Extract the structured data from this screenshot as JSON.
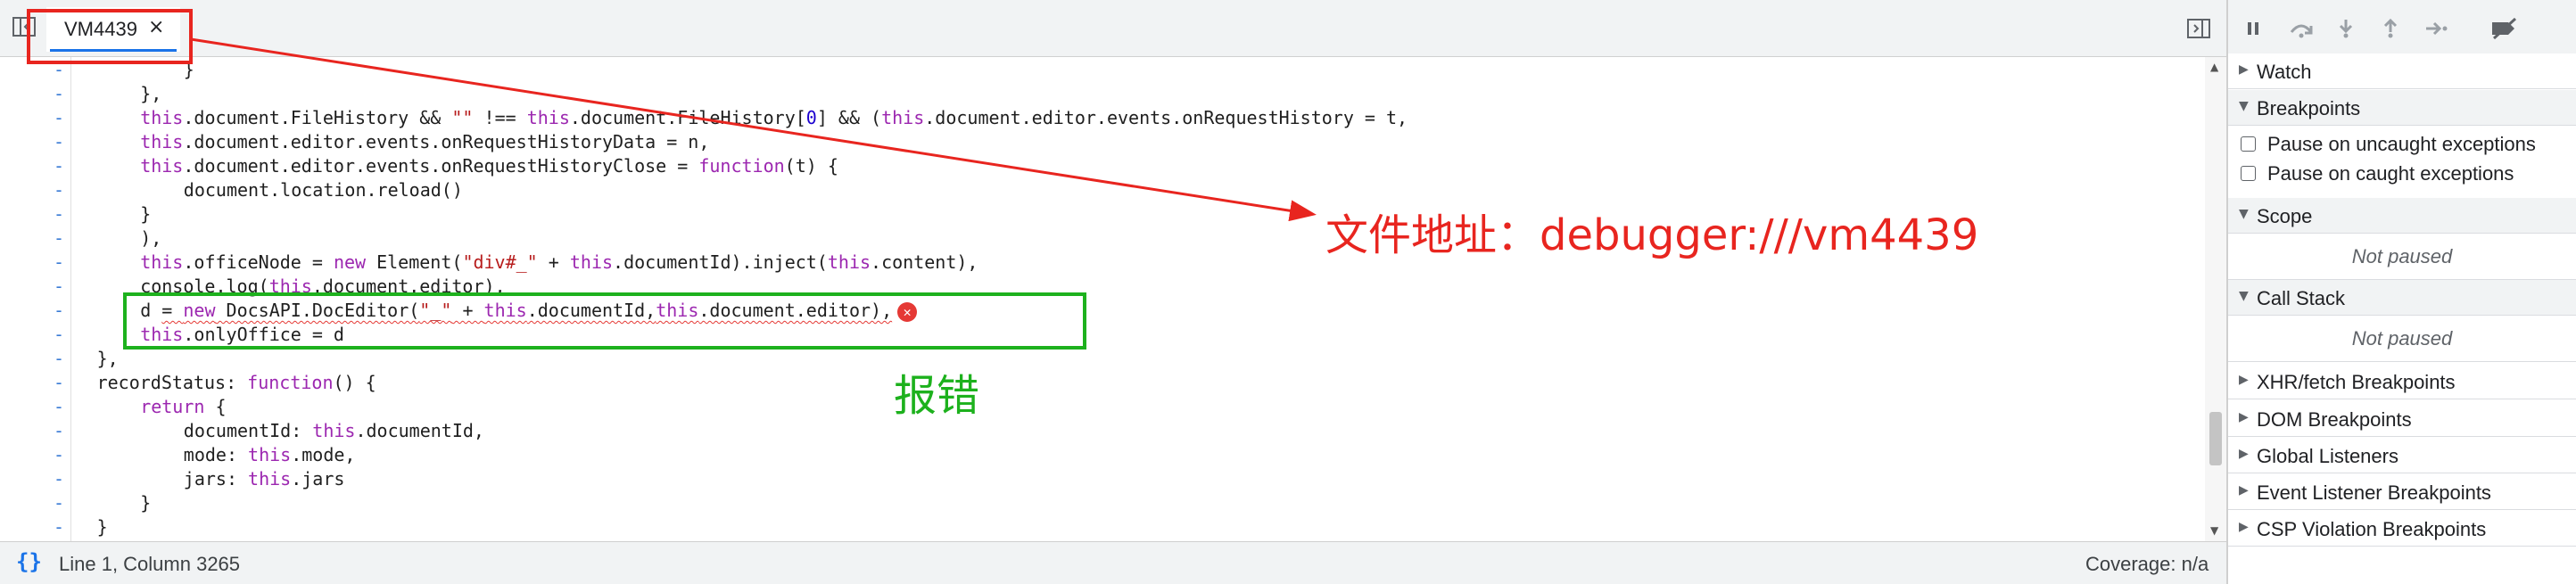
{
  "tab": {
    "label": "VM4439",
    "close": "×"
  },
  "code": [
    {
      "indent": 3,
      "parts": [
        {
          "t": "}"
        }
      ]
    },
    {
      "indent": 2,
      "parts": [
        {
          "t": "},"
        }
      ]
    },
    {
      "indent": 2,
      "parts": [
        {
          "t": "this",
          "c": "kw"
        },
        {
          "t": ".document.FileHistory && "
        },
        {
          "t": "\"\"",
          "c": "str"
        },
        {
          "t": " !== "
        },
        {
          "t": "this",
          "c": "kw"
        },
        {
          "t": ".document.FileHistory["
        },
        {
          "t": "0",
          "c": "num"
        },
        {
          "t": "] && ("
        },
        {
          "t": "this",
          "c": "kw"
        },
        {
          "t": ".document.editor.events.onRequestHistory = t,"
        }
      ]
    },
    {
      "indent": 2,
      "parts": [
        {
          "t": "this",
          "c": "kw"
        },
        {
          "t": ".document.editor.events.onRequestHistoryData = n,"
        }
      ]
    },
    {
      "indent": 2,
      "parts": [
        {
          "t": "this",
          "c": "kw"
        },
        {
          "t": ".document.editor.events.onRequestHistoryClose = "
        },
        {
          "t": "function",
          "c": "kw"
        },
        {
          "t": "(t) {"
        }
      ]
    },
    {
      "indent": 3,
      "parts": [
        {
          "t": "document.location.reload()"
        }
      ]
    },
    {
      "indent": 2,
      "parts": [
        {
          "t": "}"
        }
      ]
    },
    {
      "indent": 2,
      "parts": [
        {
          "t": "),"
        }
      ]
    },
    {
      "indent": 2,
      "parts": [
        {
          "t": "this",
          "c": "kw"
        },
        {
          "t": ".officeNode = "
        },
        {
          "t": "new",
          "c": "kw"
        },
        {
          "t": " Element("
        },
        {
          "t": "\"div#_\"",
          "c": "str"
        },
        {
          "t": " + "
        },
        {
          "t": "this",
          "c": "kw"
        },
        {
          "t": ".documentId).inject("
        },
        {
          "t": "this",
          "c": "kw"
        },
        {
          "t": ".content),"
        }
      ]
    },
    {
      "indent": 2,
      "parts": [
        {
          "t": "console.log("
        },
        {
          "t": "this",
          "c": "kw"
        },
        {
          "t": ".document.editor),"
        }
      ]
    },
    {
      "indent": 2,
      "error": true,
      "parts": [
        {
          "t": "d "
        },
        {
          "t": "= ",
          "w": true
        },
        {
          "t": "new",
          "c": "kw",
          "w": true
        },
        {
          "t": " DocsAPI.DocEditor(",
          "w": true
        },
        {
          "t": "\"_\"",
          "c": "str",
          "w": true
        },
        {
          "t": " + ",
          "w": true
        },
        {
          "t": "this",
          "c": "kw",
          "w": true
        },
        {
          "t": ".documentId,",
          "w": true
        },
        {
          "t": "this",
          "c": "kw",
          "w": true
        },
        {
          "t": ".document.editor),",
          "w": true
        }
      ]
    },
    {
      "indent": 2,
      "parts": [
        {
          "t": "this",
          "c": "kw"
        },
        {
          "t": ".onlyOffice = d"
        }
      ]
    },
    {
      "indent": 1,
      "parts": [
        {
          "t": "},"
        }
      ]
    },
    {
      "indent": 1,
      "parts": [
        {
          "t": "recordStatus: "
        },
        {
          "t": "function",
          "c": "kw"
        },
        {
          "t": "() {"
        }
      ]
    },
    {
      "indent": 2,
      "parts": [
        {
          "t": "return",
          "c": "kw"
        },
        {
          "t": " {"
        }
      ]
    },
    {
      "indent": 3,
      "parts": [
        {
          "t": "documentId: "
        },
        {
          "t": "this",
          "c": "kw"
        },
        {
          "t": ".documentId,"
        }
      ]
    },
    {
      "indent": 3,
      "parts": [
        {
          "t": "mode: "
        },
        {
          "t": "this",
          "c": "kw"
        },
        {
          "t": ".mode,"
        }
      ]
    },
    {
      "indent": 3,
      "parts": [
        {
          "t": "jars: "
        },
        {
          "t": "this",
          "c": "kw"
        },
        {
          "t": ".jars"
        }
      ]
    },
    {
      "indent": 2,
      "parts": [
        {
          "t": "}"
        }
      ]
    },
    {
      "indent": 1,
      "parts": [
        {
          "t": "}"
        }
      ]
    }
  ],
  "gutter_marker": "-",
  "status": {
    "braces": "{}",
    "position": "Line 1, Column 3265",
    "coverage": "Coverage: n/a"
  },
  "sidebar": {
    "watch": "Watch",
    "breakpoints": "Breakpoints",
    "pause_uncaught": "Pause on uncaught exceptions",
    "pause_caught": "Pause on caught exceptions",
    "scope": "Scope",
    "scope_status": "Not paused",
    "call_stack": "Call Stack",
    "call_stack_status": "Not paused",
    "xhr": "XHR/fetch Breakpoints",
    "dom": "DOM Breakpoints",
    "global": "Global Listeners",
    "event": "Event Listener Breakpoints",
    "csp": "CSP Violation Breakpoints"
  },
  "annotations": {
    "file_address": "文件地址：debugger:///vm4439",
    "error_label": "报错",
    "red": "#e8251f",
    "green": "#1db11d"
  },
  "colors": {
    "accent": "#1a73e8",
    "keyword": "#9c27b0",
    "string": "#b71c1c",
    "error": "#e53935"
  }
}
